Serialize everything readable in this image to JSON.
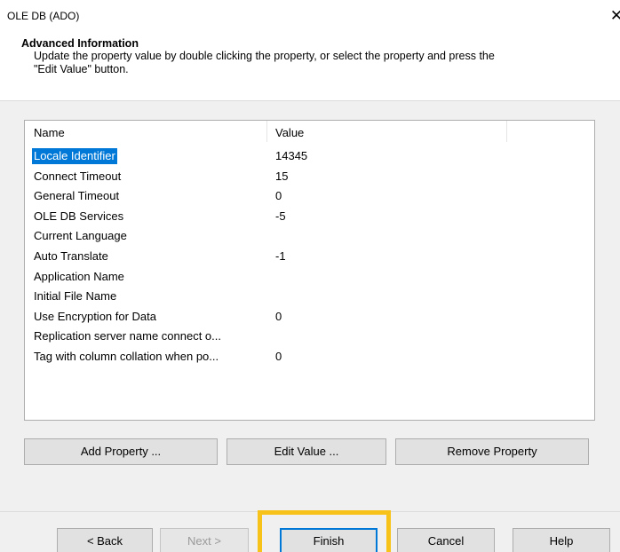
{
  "window": {
    "title": "OLE DB (ADO)",
    "close_glyph": "✕"
  },
  "header": {
    "title": "Advanced Information",
    "description_line1": "Update the property value by double clicking the property, or select the property and press the",
    "description_line2": "\"Edit Value\" button."
  },
  "properties": {
    "columns": {
      "name": "Name",
      "value": "Value"
    },
    "selected_index": 0,
    "rows": [
      {
        "name": "Locale Identifier",
        "value": "14345"
      },
      {
        "name": "Connect Timeout",
        "value": "15"
      },
      {
        "name": "General Timeout",
        "value": "0"
      },
      {
        "name": "OLE DB Services",
        "value": "-5"
      },
      {
        "name": "Current Language",
        "value": ""
      },
      {
        "name": "Auto Translate",
        "value": "-1"
      },
      {
        "name": "Application Name",
        "value": ""
      },
      {
        "name": "Initial File Name",
        "value": ""
      },
      {
        "name": "Use Encryption for Data",
        "value": "0"
      },
      {
        "name": "Replication server name connect o...",
        "value": ""
      },
      {
        "name": "Tag with column collation when po...",
        "value": "0"
      }
    ]
  },
  "actions": {
    "add_property": "Add Property ...",
    "edit_value": "Edit Value ...",
    "remove_property": "Remove Property"
  },
  "footer": {
    "back": "< Back",
    "next": "Next >",
    "finish": "Finish",
    "cancel": "Cancel",
    "help": "Help"
  },
  "colors": {
    "selection": "#0078d7",
    "highlight_frame": "#f7c21a",
    "dialog_body": "#f0f0f0"
  }
}
